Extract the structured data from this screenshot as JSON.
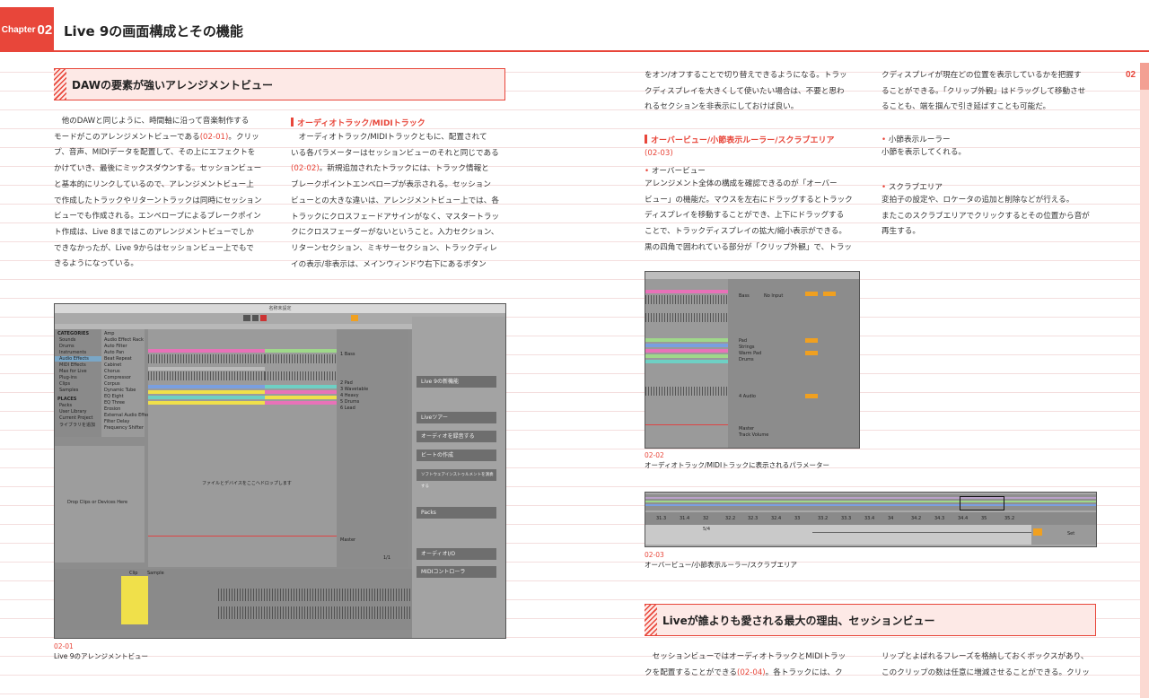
{
  "header": {
    "chapter_word": "Chapter",
    "chapter_number": "02",
    "title": "Live 9の画面構成とその機能",
    "page_number": "02"
  },
  "left": {
    "section_heading": "DAWの要素が強いアレンジメントビュー",
    "col1_lines": [
      "他のDAWと同じように、時間軸に沿って音楽制作する",
      "モードがこのアレンジメントビューである",
      "プ、音声、MIDIデータを配置して、その上にエフェクトを",
      "かけていき、最後にミックスダウンする。セッションビュー",
      "と基本的にリンクしているので、アレンジメントビュー上",
      "で作成したトラックやリターントラックは同時にセッション",
      "ビューでも作成される。エンベロープによるブレークポイン",
      "ト作成は、Live 8まではこのアレンジメントビューでしか",
      "できなかったが、Live 9からはセッションビュー上でもで",
      "きるようになっている。"
    ],
    "col1_ref": "(02-01)",
    "col1_ref_tail": "。クリッ",
    "col2_heading": "オーディオトラック/MIDIトラック",
    "col2_lines": [
      "オーディオトラック/MIDIトラックともに、配置されて",
      "いる各パラメーターはセッションビューのそれと同じである",
      "。新規追加されたトラックには、トラック情報と",
      "ブレークポイントエンベロープが表示される。セッション",
      "ビューとの大きな違いは、アレンジメントビュー上では、各",
      "トラックにクロスフェードアサインがなく、マスタートラッ",
      "クにクロスフェーダーがないということ。入力セクション、",
      "リターンセクション、ミキサーセクション、トラックディレ",
      "イの表示/非表示は、メインウィンドウ右下にあるボタン"
    ],
    "col2_ref": "(02-02)",
    "fig_num": "02-01",
    "fig_caption": "Live 9のアレンジメントビュー"
  },
  "screenshot1": {
    "window_title": "名称未設定",
    "browser_categories_label": "CATEGORIES",
    "browser_categories": [
      "Sounds",
      "Drums",
      "Instruments",
      "Audio Effects",
      "MIDI Effects",
      "Max for Live",
      "Plug-ins",
      "Clips",
      "Samples"
    ],
    "browser_places_label": "PLACES",
    "browser_places": [
      "Packs",
      "User Library",
      "Current Project",
      "ライブラリを追加"
    ],
    "browser_items": [
      "Amp",
      "Audio Effect Rack",
      "Auto Filter",
      "Auto Pan",
      "Beat Repeat",
      "Cabinet",
      "Chorus",
      "Compressor",
      "Corpus",
      "Dynamic Tube",
      "EQ Eight",
      "EQ Three",
      "Erosion",
      "External Audio Effect",
      "Filter Delay",
      "Frequency Shifter"
    ],
    "drop_hint": "Drop Clips or Devices Here",
    "arrangement_hint": "ファイルとデバイスをここへドロップします",
    "tracks": [
      "1 Bass",
      "2 Pad",
      "3 Wavetable",
      "4 Heavy",
      "5 Drums",
      "6 Lead"
    ],
    "help_title": "Live 9の新機能",
    "help_buttons": [
      "Liveツアー",
      "オーディオを録音する",
      "ビートの作成",
      "ソフトウェアインストゥルメントを演奏する",
      "Packs",
      "オーディオI/O",
      "MIDIコントローラ"
    ],
    "page_counter": "1/1",
    "clip_label": "Clip",
    "sample_label": "Sample",
    "master_label": "Master"
  },
  "right": {
    "col1_top_lines": [
      "をオン/オフすることで切り替えできるようになる。トラッ",
      "クディスプレイを大きくして使いたい場合は、不要と思わ",
      "れるセクションを非表示にしておけば良い。"
    ],
    "col2_top_lines": [
      "クディスプレイが現在どの位置を表示しているかを把握す",
      "ることができる。「クリップ外観」はドラッグして移動させ",
      "ることも、端を掴んで引き延ばすことも可能だ。"
    ],
    "overview_heading": "オーバービュー/小節表示ルーラー/スクラブエリア",
    "overview_ref": "(02-03)",
    "overview_bullet": "オーバービュー",
    "overview_lines": [
      "アレンジメント全体の構成を確認できるのが「オーバー",
      "ビュー」の機能だ。マウスを左右にドラッグするとトラック",
      "ディスプレイを移動することができ、上下にドラッグする",
      "ことで、トラックディスプレイの拡大/縮小表示ができる。",
      "黒の四角で囲われている部分が「クリップ外観」で、トラッ"
    ],
    "ruler_bullet": "小節表示ルーラー",
    "ruler_text": "小節を表示してくれる。",
    "scrub_bullet": "スクラブエリア",
    "scrub_lines": [
      "変拍子の設定や、ロケータの追加と削除などが行える。",
      "またこのスクラブエリアでクリックするとその位置から音が",
      "再生する。"
    ],
    "fig2_num": "02-02",
    "fig2_caption": "オーディオトラック/MIDIトラックに表示されるパラメーター",
    "fig3_num": "02-03",
    "fig3_caption": "オーバービュー/小節表示ルーラー/スクラブエリア",
    "section2_heading": "Liveが誰よりも愛される最大の理由、セッションビュー",
    "session_col1_line1": "セッションビューではオーディオトラックとMIDIトラッ",
    "session_col1_line2a": "クを配置することができる",
    "session_col1_ref": "(02-04)",
    "session_col1_line2b": "。各トラックには、ク",
    "session_col2_line1": "リップとよばれるフレーズを格納しておくボックスがあり、",
    "session_col2_line2": "このクリップの数は任意に増減させることができる。クリッ"
  },
  "screenshot2": {
    "tracks": [
      "Bass",
      "Pad",
      "Strings",
      "Warm Pad",
      "Drums",
      "4 Audio"
    ],
    "input": "No Input",
    "master_label": "Master",
    "volume_label": "Track Volume"
  },
  "screenshot3": {
    "ruler_marks": [
      "31.3",
      "31.4",
      "32",
      "32.2",
      "32.3",
      "32.4",
      "33",
      "33.2",
      "33.3",
      "33.4",
      "34",
      "34.2",
      "34.3",
      "34.4",
      "35",
      "35.2"
    ],
    "time_sig": "5/4",
    "set_label": "Set"
  },
  "colors": {
    "accent": "#e8463a",
    "heading_bg": "#fde9e6",
    "ruled_line": "#f4dede",
    "clip_pink": "#e872b8",
    "clip_green": "#9fd88a",
    "clip_yellow": "#f0e04a",
    "clip_teal": "#6ed0c4",
    "clip_blue": "#7a9fe0"
  }
}
